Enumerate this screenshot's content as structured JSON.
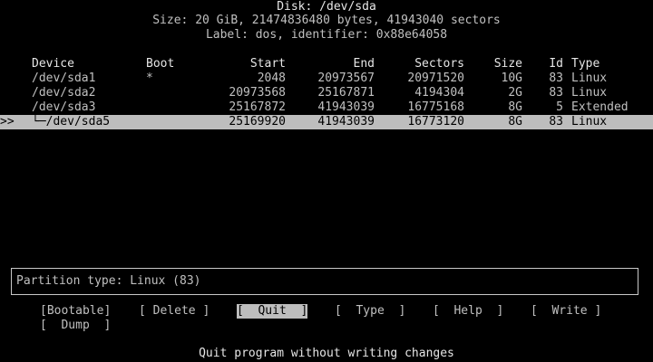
{
  "header": {
    "disk": "Disk: /dev/sda",
    "size": "Size: 20 GiB, 21474836480 bytes, 41943040 sectors",
    "label": "Label: dos, identifier: 0x88e64058"
  },
  "table": {
    "columns": {
      "device": "Device",
      "boot": "Boot",
      "start": "Start",
      "end": "End",
      "sectors": "Sectors",
      "size": "Size",
      "id": "Id",
      "type": "Type"
    },
    "rows": [
      {
        "marker": "",
        "device": "/dev/sda1",
        "boot": "*",
        "start": "2048",
        "end": "20973567",
        "sectors": "20971520",
        "size": "10G",
        "id": "83",
        "type": "Linux"
      },
      {
        "marker": "",
        "device": "/dev/sda2",
        "boot": "",
        "start": "20973568",
        "end": "25167871",
        "sectors": "4194304",
        "size": "2G",
        "id": "83",
        "type": "Linux"
      },
      {
        "marker": "",
        "device": "/dev/sda3",
        "boot": "",
        "start": "25167872",
        "end": "41943039",
        "sectors": "16775168",
        "size": "8G",
        "id": "5",
        "type": "Extended"
      },
      {
        "marker": ">>",
        "device": "└─/dev/sda5",
        "boot": "",
        "start": "25169920",
        "end": "41943039",
        "sectors": "16773120",
        "size": "8G",
        "id": "83",
        "type": "Linux"
      }
    ]
  },
  "info": {
    "text": "Partition type: Linux (83)"
  },
  "menu": {
    "bootable": "[Bootable]",
    "delete": "[ Delete ]",
    "quit": "[  Quit  ]",
    "type": "[  Type  ]",
    "help": "[  Help  ]",
    "write": "[  Write ]",
    "dump": "[  Dump  ]"
  },
  "hint": "Quit program without writing changes",
  "colors": {
    "background": "#000000",
    "text": "#c0c0c0",
    "highlight": "#bdbdbd"
  }
}
